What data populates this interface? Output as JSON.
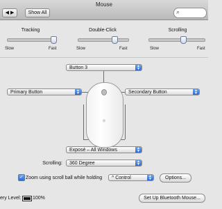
{
  "window": {
    "title": "Mouse"
  },
  "toolbar": {
    "show_all_label": "Show All",
    "search_placeholder": ""
  },
  "sliders": [
    {
      "label": "Tracking",
      "min_label": "Slow",
      "max_label": "Fast",
      "value": 0.95
    },
    {
      "label": "Double-Click",
      "min_label": "Slow",
      "max_label": "Fast",
      "value": 0.74
    },
    {
      "label": "Scrolling",
      "min_label": "Slow",
      "max_label": "Fast",
      "value": 0.62
    }
  ],
  "buttons": {
    "top": "Button 3",
    "left": "Primary Button",
    "right": "Secondary Button",
    "bottom": "Exposé – All Windows"
  },
  "scrolling": {
    "label": "Scrolling:",
    "value": "360 Degree"
  },
  "zoom": {
    "checked": true,
    "label": "Zoom using scroll ball while holding",
    "modifier": "^ Control",
    "options_label": "Options..."
  },
  "footer": {
    "battery_label": "ery Level:",
    "battery_value": "100%",
    "bluetooth_label": "Set Up Bluetooth Mouse..."
  }
}
